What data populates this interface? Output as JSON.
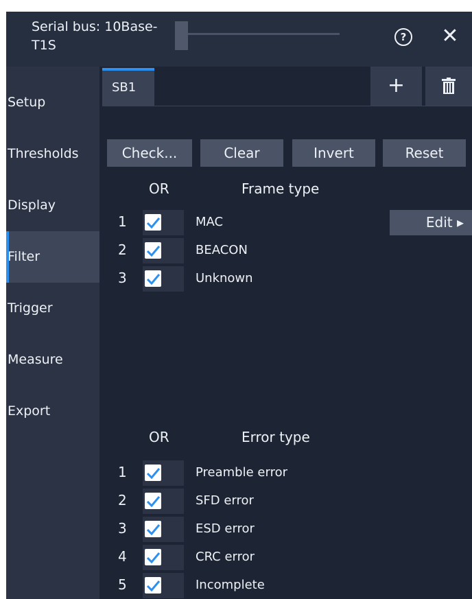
{
  "header": {
    "title": "Serial bus: 10Base-T1S",
    "help_icon": "question-circle-icon",
    "close_icon": "close-icon"
  },
  "sidebar": {
    "items": [
      {
        "label": "Setup"
      },
      {
        "label": "Thresholds"
      },
      {
        "label": "Display"
      },
      {
        "label": "Filter",
        "active": true
      },
      {
        "label": "Trigger"
      },
      {
        "label": "Measure"
      },
      {
        "label": "Export"
      }
    ]
  },
  "tabs": {
    "items": [
      {
        "label": "SB1",
        "active": true
      }
    ],
    "add_label": "+",
    "delete_icon": "trash-icon"
  },
  "actions": {
    "check": "Check...",
    "clear": "Clear",
    "invert": "Invert",
    "reset": "Reset"
  },
  "frame_filter": {
    "col_or": "OR",
    "col_type": "Frame type",
    "edit_label": "Edit ▸",
    "rows": [
      {
        "num": "1",
        "label": "MAC",
        "checked": true
      },
      {
        "num": "2",
        "label": "BEACON",
        "checked": true
      },
      {
        "num": "3",
        "label": "Unknown",
        "checked": true
      }
    ]
  },
  "error_filter": {
    "col_or": "OR",
    "col_type": "Error type",
    "rows": [
      {
        "num": "1",
        "label": "Preamble error",
        "checked": true
      },
      {
        "num": "2",
        "label": "SFD error",
        "checked": true
      },
      {
        "num": "3",
        "label": "ESD error",
        "checked": true
      },
      {
        "num": "4",
        "label": "CRC error",
        "checked": true
      },
      {
        "num": "5",
        "label": "Incomplete",
        "checked": true
      }
    ]
  },
  "colors": {
    "accent": "#2e90ee",
    "background": "#1d2433",
    "sidebar": "#2b3345",
    "button": "#4a5466"
  }
}
